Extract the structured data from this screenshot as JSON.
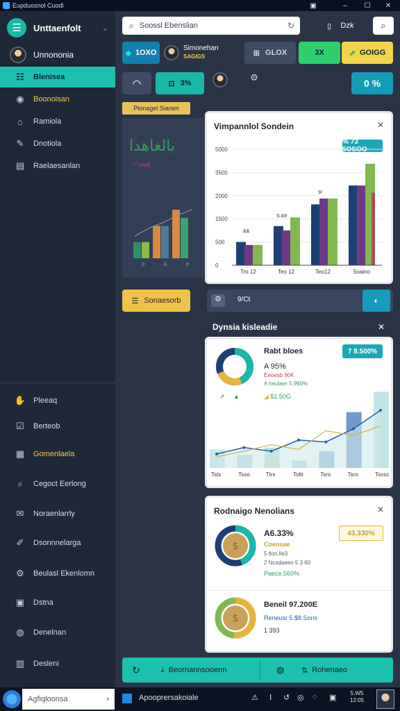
{
  "titlebar": {
    "title": "Eupduosnol Cuodl",
    "icons": [
      "doc-icon",
      "minimize-icon",
      "maximize-icon",
      "close-icon"
    ]
  },
  "sidebar": {
    "title": "Unttaenfolt",
    "user_name": "Unnononia",
    "items_top": [
      {
        "label": "Blenisea",
        "icon": "list-icon",
        "active": true
      },
      {
        "label": "Boonoisan",
        "icon": "eye-icon",
        "gold": true
      },
      {
        "label": "Ramiola",
        "icon": "home-icon"
      },
      {
        "label": "Dnotiola",
        "icon": "pin-icon"
      },
      {
        "label": "Raelaesanlan",
        "icon": "chart-icon"
      }
    ],
    "items_bottom": [
      {
        "label": "Pleeaq",
        "icon": "hand-icon"
      },
      {
        "label": "Berteob",
        "icon": "check-icon"
      },
      {
        "label": "Gomenlaela",
        "icon": "image-icon",
        "gold": true
      },
      {
        "label": "Cegoct Eerlong",
        "icon": "tag-icon"
      },
      {
        "label": "Noraenlarrly",
        "icon": "mail-icon"
      },
      {
        "label": "Dsonnnelarga",
        "icon": "wrench-icon"
      },
      {
        "label": "Beulasl Ekenlomn",
        "icon": "gear-icon"
      },
      {
        "label": "Dstna",
        "icon": "table-icon"
      },
      {
        "label": "Denelnan",
        "icon": "globe-icon"
      },
      {
        "label": "Desleni",
        "icon": "clipboard-icon"
      }
    ]
  },
  "search": {
    "placeholder": "Soossl Ebenslian"
  },
  "toolbar": {
    "sync_label": "Dzk"
  },
  "status": {
    "pill1": "1OXO",
    "user_name": "Simonehan",
    "user_sub": "SAGIGS",
    "pill2": "GLOX",
    "pill3": "3X",
    "pill4": "GOIGG",
    "pill5": "3%",
    "pill6": "0 %"
  },
  "left_panel": {
    "tag": "Plonagel Sianen",
    "script_text": "بالغاهدا",
    "sub_text": "- ^ usal",
    "bar_values": [
      2,
      2,
      4,
      4,
      6,
      5
    ],
    "bar_colors": [
      "#2f8f6a",
      "#8aba45",
      "#d98a3f",
      "#4e7a9b",
      "#d98a3f",
      "#3aa36f"
    ],
    "ticks": [
      "0",
      "0",
      "0"
    ]
  },
  "bar_card": {
    "title": "Vimpannlol Sondein",
    "badge": "% 73 5OSOO",
    "y_ticks": [
      "5000",
      "3500",
      "2000",
      "1500",
      "500",
      "0"
    ],
    "x_ticks": [
      "Tro 12",
      "Teo 12",
      "Teo12",
      "Soaino"
    ],
    "anno": [
      "9/",
      "S.&9",
      "&&"
    ]
  },
  "chart_data": [
    {
      "type": "bar",
      "categories": [
        "Tro 12",
        "Teo 12",
        "Teo12",
        "Soaino"
      ],
      "y_ticks": [
        "5000",
        "3500",
        "2000",
        "1500",
        "500",
        "0"
      ],
      "series": [
        {
          "values": [
            800,
            1350,
            2100,
            2750
          ],
          "color": "#1e3f73"
        },
        {
          "values": [
            700,
            1200,
            2300,
            2750
          ],
          "color": "#6e3a86"
        },
        {
          "values": [
            700,
            1650,
            2300,
            3500
          ],
          "color": "#82b84f"
        },
        {
          "values": [
            0,
            0,
            0,
            2500
          ],
          "color": "#b04a5a"
        }
      ],
      "ylim": [
        0,
        4000
      ]
    },
    {
      "type": "area",
      "x": [
        "Tsts",
        "Tsso",
        "Ttrs",
        "Toltr",
        "Tsrs",
        "Tsro",
        "Tsosc"
      ],
      "values": [
        15,
        22,
        18,
        30,
        28,
        42,
        62
      ],
      "bars": [
        20,
        14,
        22,
        8,
        18,
        60,
        82
      ],
      "line2": [
        12,
        18,
        25,
        20,
        40,
        35,
        45
      ]
    }
  ],
  "mid_row": {
    "btn_label": "Sonaesorb",
    "tool_label": "9/Ct"
  },
  "donut_panel": {
    "title": "Dynsia kisleadie",
    "card_title": "Rabt bloes",
    "badge": "7 8.500%",
    "stat1": "A 95%",
    "stat2": "Eeoesb 90K",
    "stat3": "A heulaer 5.990%",
    "stat4": "$1.50G",
    "x_ticks": [
      "Tsts",
      "Tsso",
      "Ttrs",
      "Toltr",
      "Tsrs",
      "Tsro",
      "Tsosc"
    ]
  },
  "coin_panel": {
    "title": "Rodnaigo Nenolians",
    "row1": {
      "stat": "A6.33%",
      "gold": "Coensae",
      "sub1": "5 tlon.lle3",
      "sub2": "2 Ncsdaeen 5 3 60",
      "green": "Paece.560%",
      "badge": "43.330%"
    },
    "row2": {
      "stat": "Beneil 97.200E",
      "blue": "Reneusr 5.$8.Sons",
      "sub": "1 393"
    }
  },
  "bottombar": {
    "left_label": "Beornannsooenn",
    "right_label": "Rohenaeo"
  },
  "taskbar": {
    "search_placeholder": "Agfiqloonsa",
    "app_label": "Apooprersakoiale",
    "clock_line1": "5.W5",
    "clock_line2": "12:05"
  }
}
